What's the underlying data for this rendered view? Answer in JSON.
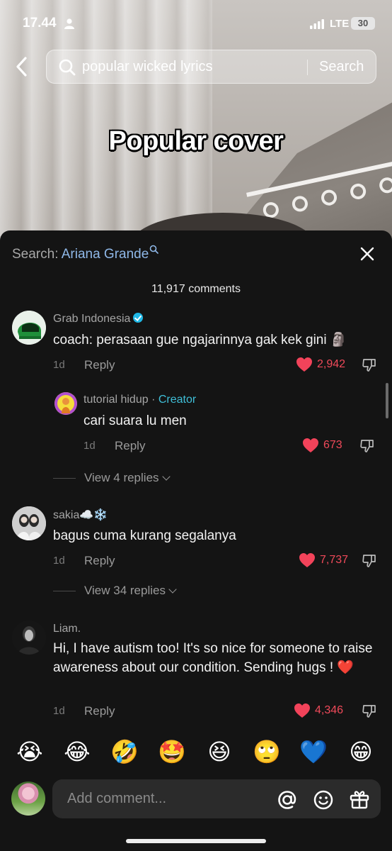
{
  "status_bar": {
    "time": "17.44",
    "network": "LTE",
    "battery": "30"
  },
  "search": {
    "query": "popular wicked lyrics",
    "button_label": "Search"
  },
  "video": {
    "overlay_text": "Popular cover"
  },
  "sheet": {
    "search_prefix": "Search: ",
    "search_term": "Ariana Grande",
    "comment_count": "11,917 comments"
  },
  "comments": [
    {
      "username": "Grab Indonesia",
      "verified": true,
      "text": "coach: perasaan gue ngajarinnya gak kek gini 🗿",
      "time": "1d",
      "reply_label": "Reply",
      "likes": "2,942"
    },
    {
      "username": "tutorial hidup",
      "separator": " · ",
      "tag": "Creator",
      "text": "cari suara lu men",
      "time": "1d",
      "reply_label": "Reply",
      "likes": "673"
    },
    {
      "username": "sakia☁️❄️",
      "text": "bagus cuma kurang segalanya",
      "time": "1d",
      "reply_label": "Reply",
      "likes": "7,737"
    },
    {
      "username": "Liam.",
      "text": "Hi, I have autism too! It's so nice for someone to raise awareness about our condition. Sending hugs ! ❤️",
      "time": "1d",
      "reply_label": "Reply",
      "likes": "4,346"
    }
  ],
  "view_replies": [
    "View 4 replies",
    "View 34 replies"
  ],
  "emoji_bar": [
    "😭",
    "😂",
    "🤣",
    "🤩",
    "😆",
    "🙄",
    "💙",
    "😁"
  ],
  "input": {
    "placeholder": "Add comment..."
  },
  "colors": {
    "sheet_bg": "#141414",
    "like_red": "#f04a5a",
    "link_blue": "#8fb8e8",
    "creator_teal": "#3fbfd8"
  }
}
